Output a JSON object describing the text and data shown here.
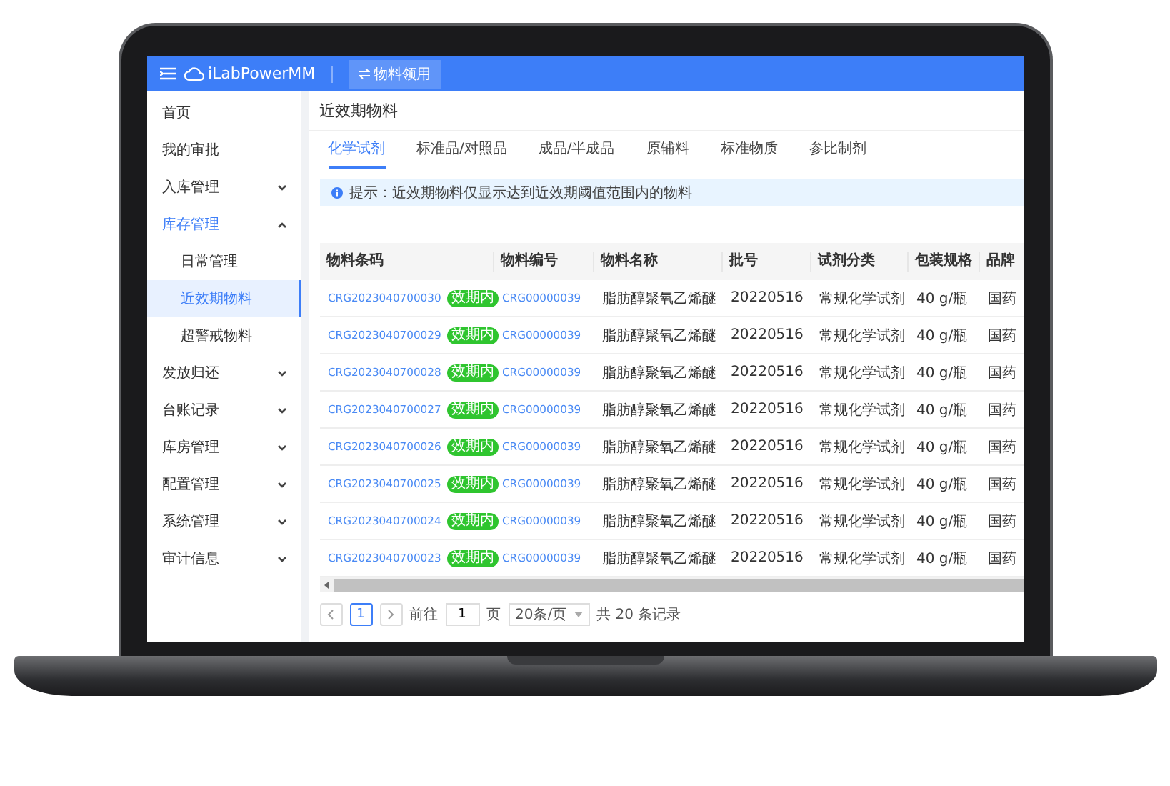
{
  "header": {
    "logo": "iLabPowerMM",
    "action_button": "物料领用"
  },
  "sidebar": {
    "items": [
      {
        "label": "首页",
        "kind": "link",
        "selected": false
      },
      {
        "label": "我的审批",
        "kind": "link",
        "selected": false
      },
      {
        "label": "入库管理",
        "kind": "group",
        "expanded": false,
        "selected": false
      },
      {
        "label": "库存管理",
        "kind": "group",
        "expanded": true,
        "selected": true,
        "children": [
          {
            "label": "日常管理",
            "selected": false
          },
          {
            "label": "近效期物料",
            "selected": true
          },
          {
            "label": "超警戒物料",
            "selected": false
          }
        ]
      },
      {
        "label": "发放归还",
        "kind": "group",
        "expanded": false,
        "selected": false
      },
      {
        "label": "台账记录",
        "kind": "group",
        "expanded": false,
        "selected": false
      },
      {
        "label": "库房管理",
        "kind": "group",
        "expanded": false,
        "selected": false
      },
      {
        "label": "配置管理",
        "kind": "group",
        "expanded": false,
        "selected": false
      },
      {
        "label": "系统管理",
        "kind": "group",
        "expanded": false,
        "selected": false
      },
      {
        "label": "审计信息",
        "kind": "group",
        "expanded": false,
        "selected": false
      }
    ]
  },
  "page_title": "近效期物料",
  "tabs": [
    {
      "label": "化学试剂",
      "selected": true
    },
    {
      "label": "标准品/对照品",
      "selected": false
    },
    {
      "label": "成品/半成品",
      "selected": false
    },
    {
      "label": "原辅料",
      "selected": false
    },
    {
      "label": "标准物质",
      "selected": false
    },
    {
      "label": "参比制剂",
      "selected": false
    }
  ],
  "notice": "提示：近效期物料仅显示达到近效期阈值范围内的物料",
  "table": {
    "columns": [
      "物料条码",
      "物料编号",
      "物料名称",
      "批号",
      "试剂分类",
      "包装规格",
      "品牌"
    ],
    "rows": [
      {
        "barcode": "CRG2023040700030",
        "tag": "效期内",
        "code": "CRG00000039",
        "name": "脂肪醇聚氧乙烯醚",
        "batch": "20220516",
        "category": "常规化学试剂",
        "package": "40 g/瓶",
        "brand": "国药"
      },
      {
        "barcode": "CRG2023040700029",
        "tag": "效期内",
        "code": "CRG00000039",
        "name": "脂肪醇聚氧乙烯醚",
        "batch": "20220516",
        "category": "常规化学试剂",
        "package": "40 g/瓶",
        "brand": "国药"
      },
      {
        "barcode": "CRG2023040700028",
        "tag": "效期内",
        "code": "CRG00000039",
        "name": "脂肪醇聚氧乙烯醚",
        "batch": "20220516",
        "category": "常规化学试剂",
        "package": "40 g/瓶",
        "brand": "国药"
      },
      {
        "barcode": "CRG2023040700027",
        "tag": "效期内",
        "code": "CRG00000039",
        "name": "脂肪醇聚氧乙烯醚",
        "batch": "20220516",
        "category": "常规化学试剂",
        "package": "40 g/瓶",
        "brand": "国药"
      },
      {
        "barcode": "CRG2023040700026",
        "tag": "效期内",
        "code": "CRG00000039",
        "name": "脂肪醇聚氧乙烯醚",
        "batch": "20220516",
        "category": "常规化学试剂",
        "package": "40 g/瓶",
        "brand": "国药"
      },
      {
        "barcode": "CRG2023040700025",
        "tag": "效期内",
        "code": "CRG00000039",
        "name": "脂肪醇聚氧乙烯醚",
        "batch": "20220516",
        "category": "常规化学试剂",
        "package": "40 g/瓶",
        "brand": "国药"
      },
      {
        "barcode": "CRG2023040700024",
        "tag": "效期内",
        "code": "CRG00000039",
        "name": "脂肪醇聚氧乙烯醚",
        "batch": "20220516",
        "category": "常规化学试剂",
        "package": "40 g/瓶",
        "brand": "国药"
      },
      {
        "barcode": "CRG2023040700023",
        "tag": "效期内",
        "code": "CRG00000039",
        "name": "脂肪醇聚氧乙烯醚",
        "batch": "20220516",
        "category": "常规化学试剂",
        "package": "40 g/瓶",
        "brand": "国药"
      }
    ]
  },
  "pagination": {
    "pages": [
      {
        "label": "1",
        "selected": true
      }
    ],
    "goto_label": "前往",
    "goto_value": "1",
    "page_unit": "页",
    "page_size": "20条/页",
    "total": "共 20 条记录"
  }
}
